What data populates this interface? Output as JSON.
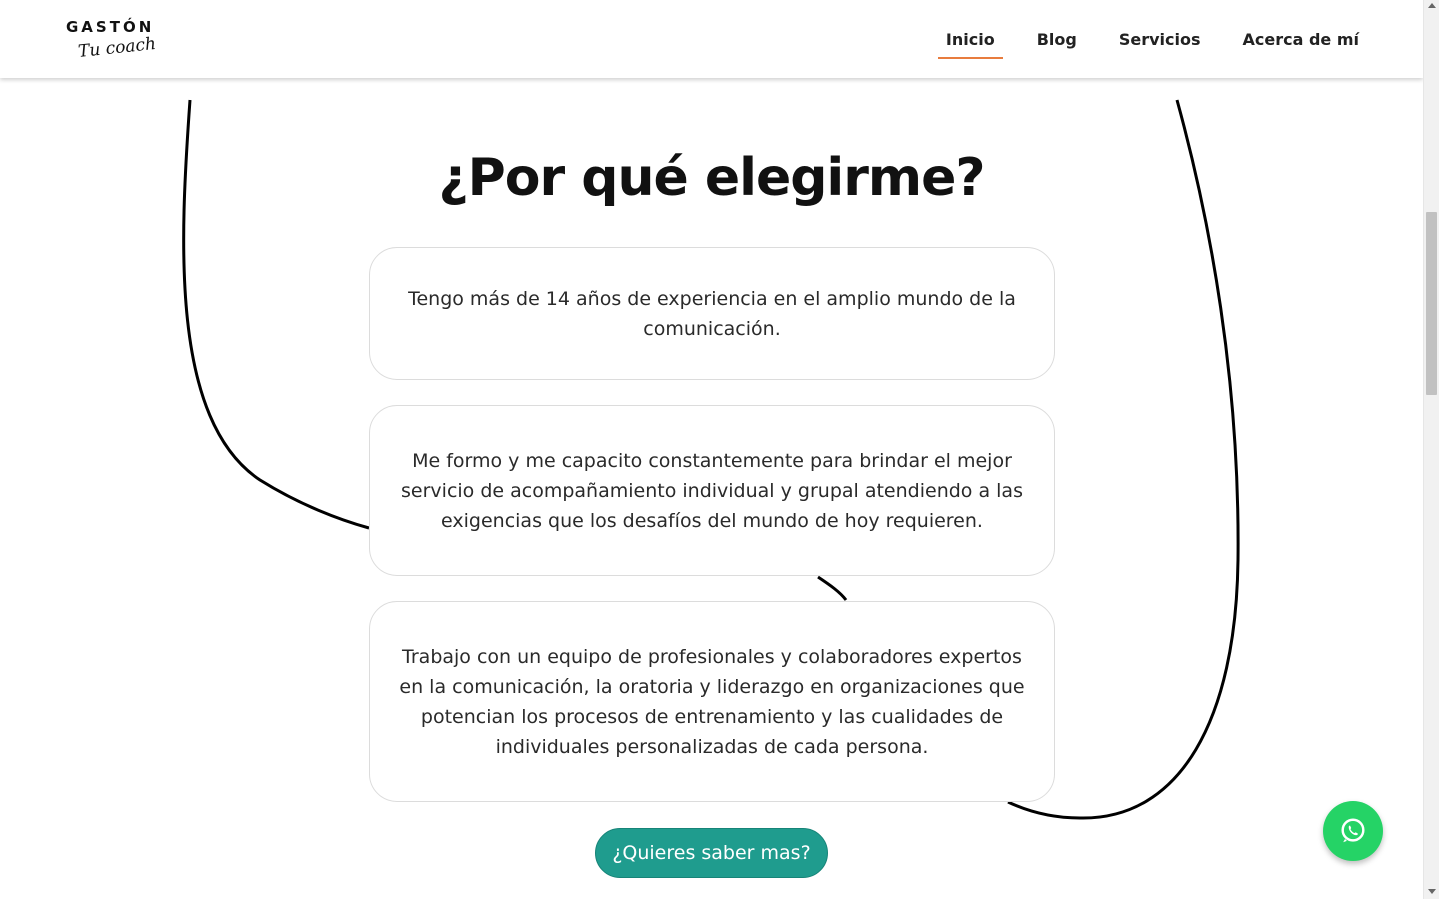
{
  "logo": {
    "top": "GASTÓN",
    "sub": "Tu coach"
  },
  "nav": {
    "items": [
      {
        "label": "Inicio",
        "active": true
      },
      {
        "label": "Blog",
        "active": false
      },
      {
        "label": "Servicios",
        "active": false
      },
      {
        "label": "Acerca de mí",
        "active": false
      }
    ]
  },
  "section": {
    "title": "¿Por qué elegirme?",
    "cards": [
      "Tengo más de 14 años de experiencia en el amplio mundo de la comunicación.",
      "Me formo y me capacito constantemente para brindar el mejor servicio de acompañamiento individual y grupal atendiendo a las exigencias que los desafíos del mundo de hoy requieren.",
      "Trabajo con un equipo de profesionales y colaboradores expertos en la comunicación, la oratoria y liderazgo en organizaciones que potencian los procesos de entrenamiento y las cualidades de individuales personalizadas de cada persona."
    ],
    "cta_label": "¿Quieres saber mas?"
  },
  "icons": {
    "whatsapp": "whatsapp-icon"
  },
  "colors": {
    "accent": "#e87c3e",
    "cta": "#1f9c8e",
    "whatsapp": "#25d366"
  }
}
